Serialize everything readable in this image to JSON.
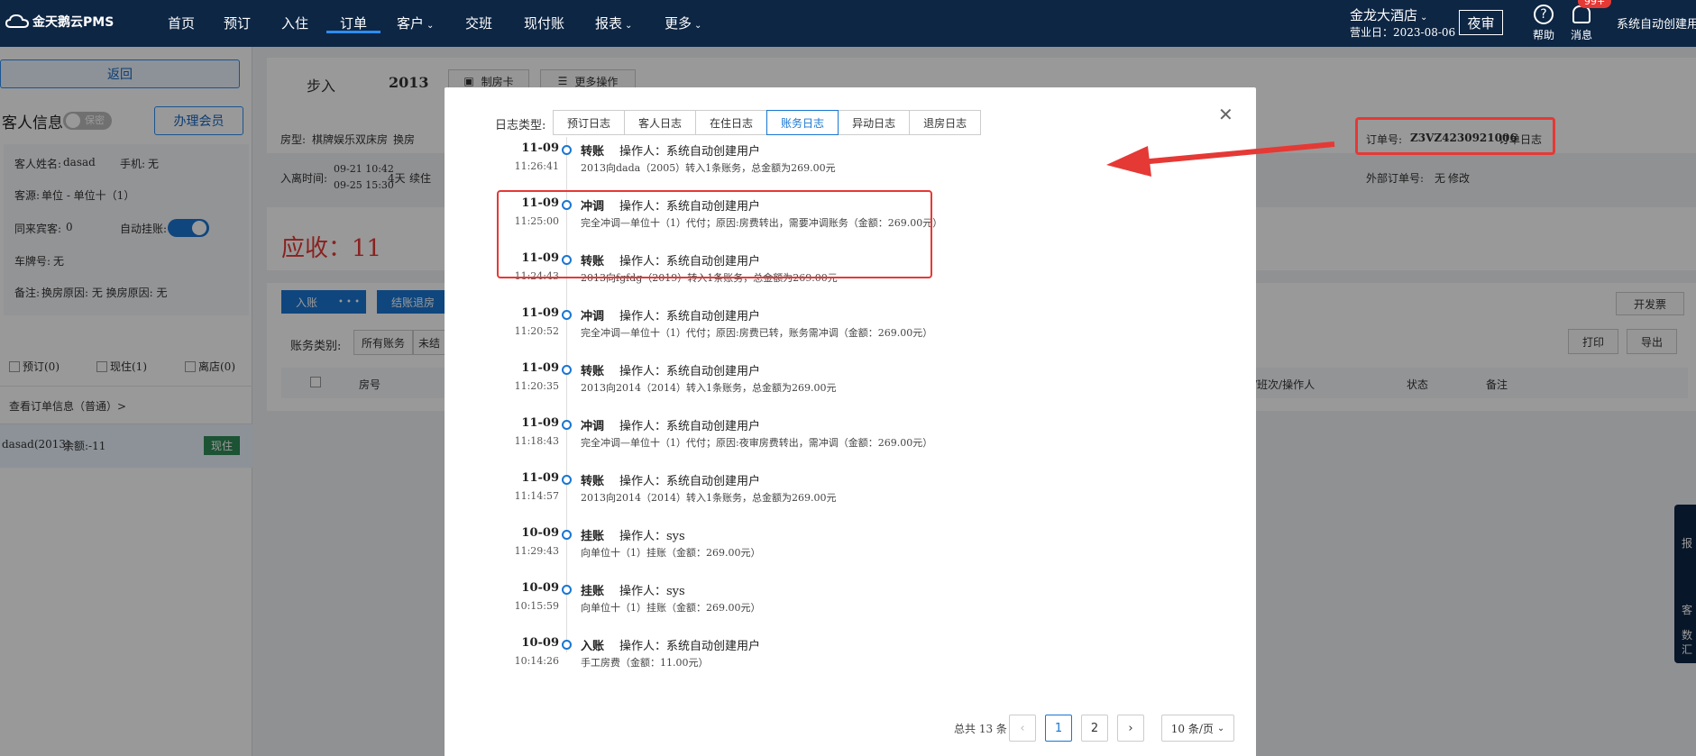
{
  "topnav": {
    "logo": "金天鹅云PMS",
    "items": [
      "首页",
      "预订",
      "入住",
      "订单",
      "客户",
      "交班",
      "现付账",
      "报表",
      "更多"
    ],
    "hotel": "金龙大酒店",
    "business_day": "营业日：2023-08-06",
    "night_audit": "夜审",
    "help": "帮助",
    "messages": "消息",
    "badge": "99+",
    "user": "系统自动创建用户"
  },
  "sidebar": {
    "back": "返回",
    "guest_info_title": "客人信息",
    "privacy_toggle": "保密",
    "vip_button": "办理会员",
    "guest_name_label": "客人姓名:",
    "guest_name": "dasad",
    "phone_label": "手机:",
    "phone": "无",
    "source_label": "客源:",
    "source": "单位 - 单位十（1）",
    "companions_label": "同来宾客:",
    "companions": "0",
    "auto_hang_label": "自动挂账:",
    "plate_label": "车牌号:",
    "plate": "无",
    "remark_label": "备注:",
    "remark": "换房原因: 无 换房原因: 无",
    "checkbox_booked": "预订(0)",
    "checkbox_in": "现住(1)",
    "checkbox_left": "离店(0)",
    "view_order": "查看订单信息（普通）>",
    "room_item": "dasad(2013)",
    "room_balance": "余额:-11",
    "room_status": "现住"
  },
  "main": {
    "room_name": "步入",
    "room_no": "2013",
    "make_card": "制房卡",
    "more_ops": "更多操作",
    "room_type_label": "房型:",
    "room_type": "棋牌娱乐双床房",
    "change_room": "换房",
    "stay_label": "入离时间:",
    "stay_in": "09-21 10:42",
    "stay_out": "09-25 15:30",
    "stay_days": "4天",
    "extend": "续住",
    "receivable": "应收：11",
    "order_no_label": "订单号:",
    "order_no": "Z3VZ4230921006",
    "order_log": "订单日志",
    "ext_order_label": "外部订单号:",
    "ext_order": "无",
    "modify": "修改",
    "btn_post": "入账",
    "btn_more": "• • •",
    "btn_checkout": "结账退房",
    "btn_invoice": "开发票",
    "acct_type_label": "账务类别:",
    "acct_all": "所有账务",
    "acct_unsettled": "未结",
    "btn_print": "打印",
    "btn_export": "导出",
    "col_room": "房号",
    "col_shift": "/班次/操作人",
    "col_status": "状态",
    "col_remark": "备注"
  },
  "righttool": {
    "a": "报",
    "b": "客",
    "c": "数",
    "d": "汇"
  },
  "modal": {
    "log_type_label": "日志类型:",
    "tabs": [
      {
        "label": "预订日志",
        "active": false
      },
      {
        "label": "客人日志",
        "active": false
      },
      {
        "label": "在住日志",
        "active": false
      },
      {
        "label": "账务日志",
        "active": true
      },
      {
        "label": "异动日志",
        "active": false
      },
      {
        "label": "退房日志",
        "active": false
      }
    ],
    "entries": [
      {
        "date": "11-09",
        "time": "11:26:41",
        "type": "转账",
        "operator": "操作人：系统自动创建用户",
        "desc": "2013向dada（2005）转入1条账务，总金额为269.00元"
      },
      {
        "date": "11-09",
        "time": "11:25:00",
        "type": "冲调",
        "operator": "操作人：系统自动创建用户",
        "desc": "完全冲调—单位十（1）代付；原因:房费转出，需要冲调账务（金额：269.00元）"
      },
      {
        "date": "11-09",
        "time": "11:24:43",
        "type": "转账",
        "operator": "操作人：系统自动创建用户",
        "desc": "2013向fgfdg（2019）转入1条账务，总金额为269.00元"
      },
      {
        "date": "11-09",
        "time": "11:20:52",
        "type": "冲调",
        "operator": "操作人：系统自动创建用户",
        "desc": "完全冲调—单位十（1）代付；原因:房费已转，账务需冲调（金额：269.00元）"
      },
      {
        "date": "11-09",
        "time": "11:20:35",
        "type": "转账",
        "operator": "操作人：系统自动创建用户",
        "desc": "2013向2014（2014）转入1条账务，总金额为269.00元"
      },
      {
        "date": "11-09",
        "time": "11:18:43",
        "type": "冲调",
        "operator": "操作人：系统自动创建用户",
        "desc": "完全冲调—单位十（1）代付；原因:夜审房费转出，需冲调（金额：269.00元）"
      },
      {
        "date": "11-09",
        "time": "11:14:57",
        "type": "转账",
        "operator": "操作人：系统自动创建用户",
        "desc": "2013向2014（2014）转入1条账务，总金额为269.00元"
      },
      {
        "date": "10-09",
        "time": "11:29:43",
        "type": "挂账",
        "operator": "操作人：sys",
        "desc": "向单位十（1）挂账（金额：269.00元）"
      },
      {
        "date": "10-09",
        "time": "10:15:59",
        "type": "挂账",
        "operator": "操作人：sys",
        "desc": "向单位十（1）挂账（金额：269.00元）"
      },
      {
        "date": "10-09",
        "time": "10:14:26",
        "type": "入账",
        "operator": "操作人：系统自动创建用户",
        "desc": "手工房费（金额：11.00元）"
      }
    ],
    "total": "总共 13 条",
    "pages": [
      "1",
      "2"
    ],
    "page_size": "10 条/页"
  },
  "colors": {
    "nav_bg": "#0d2644",
    "accent": "#1976d2",
    "highlight": "#e53935"
  }
}
